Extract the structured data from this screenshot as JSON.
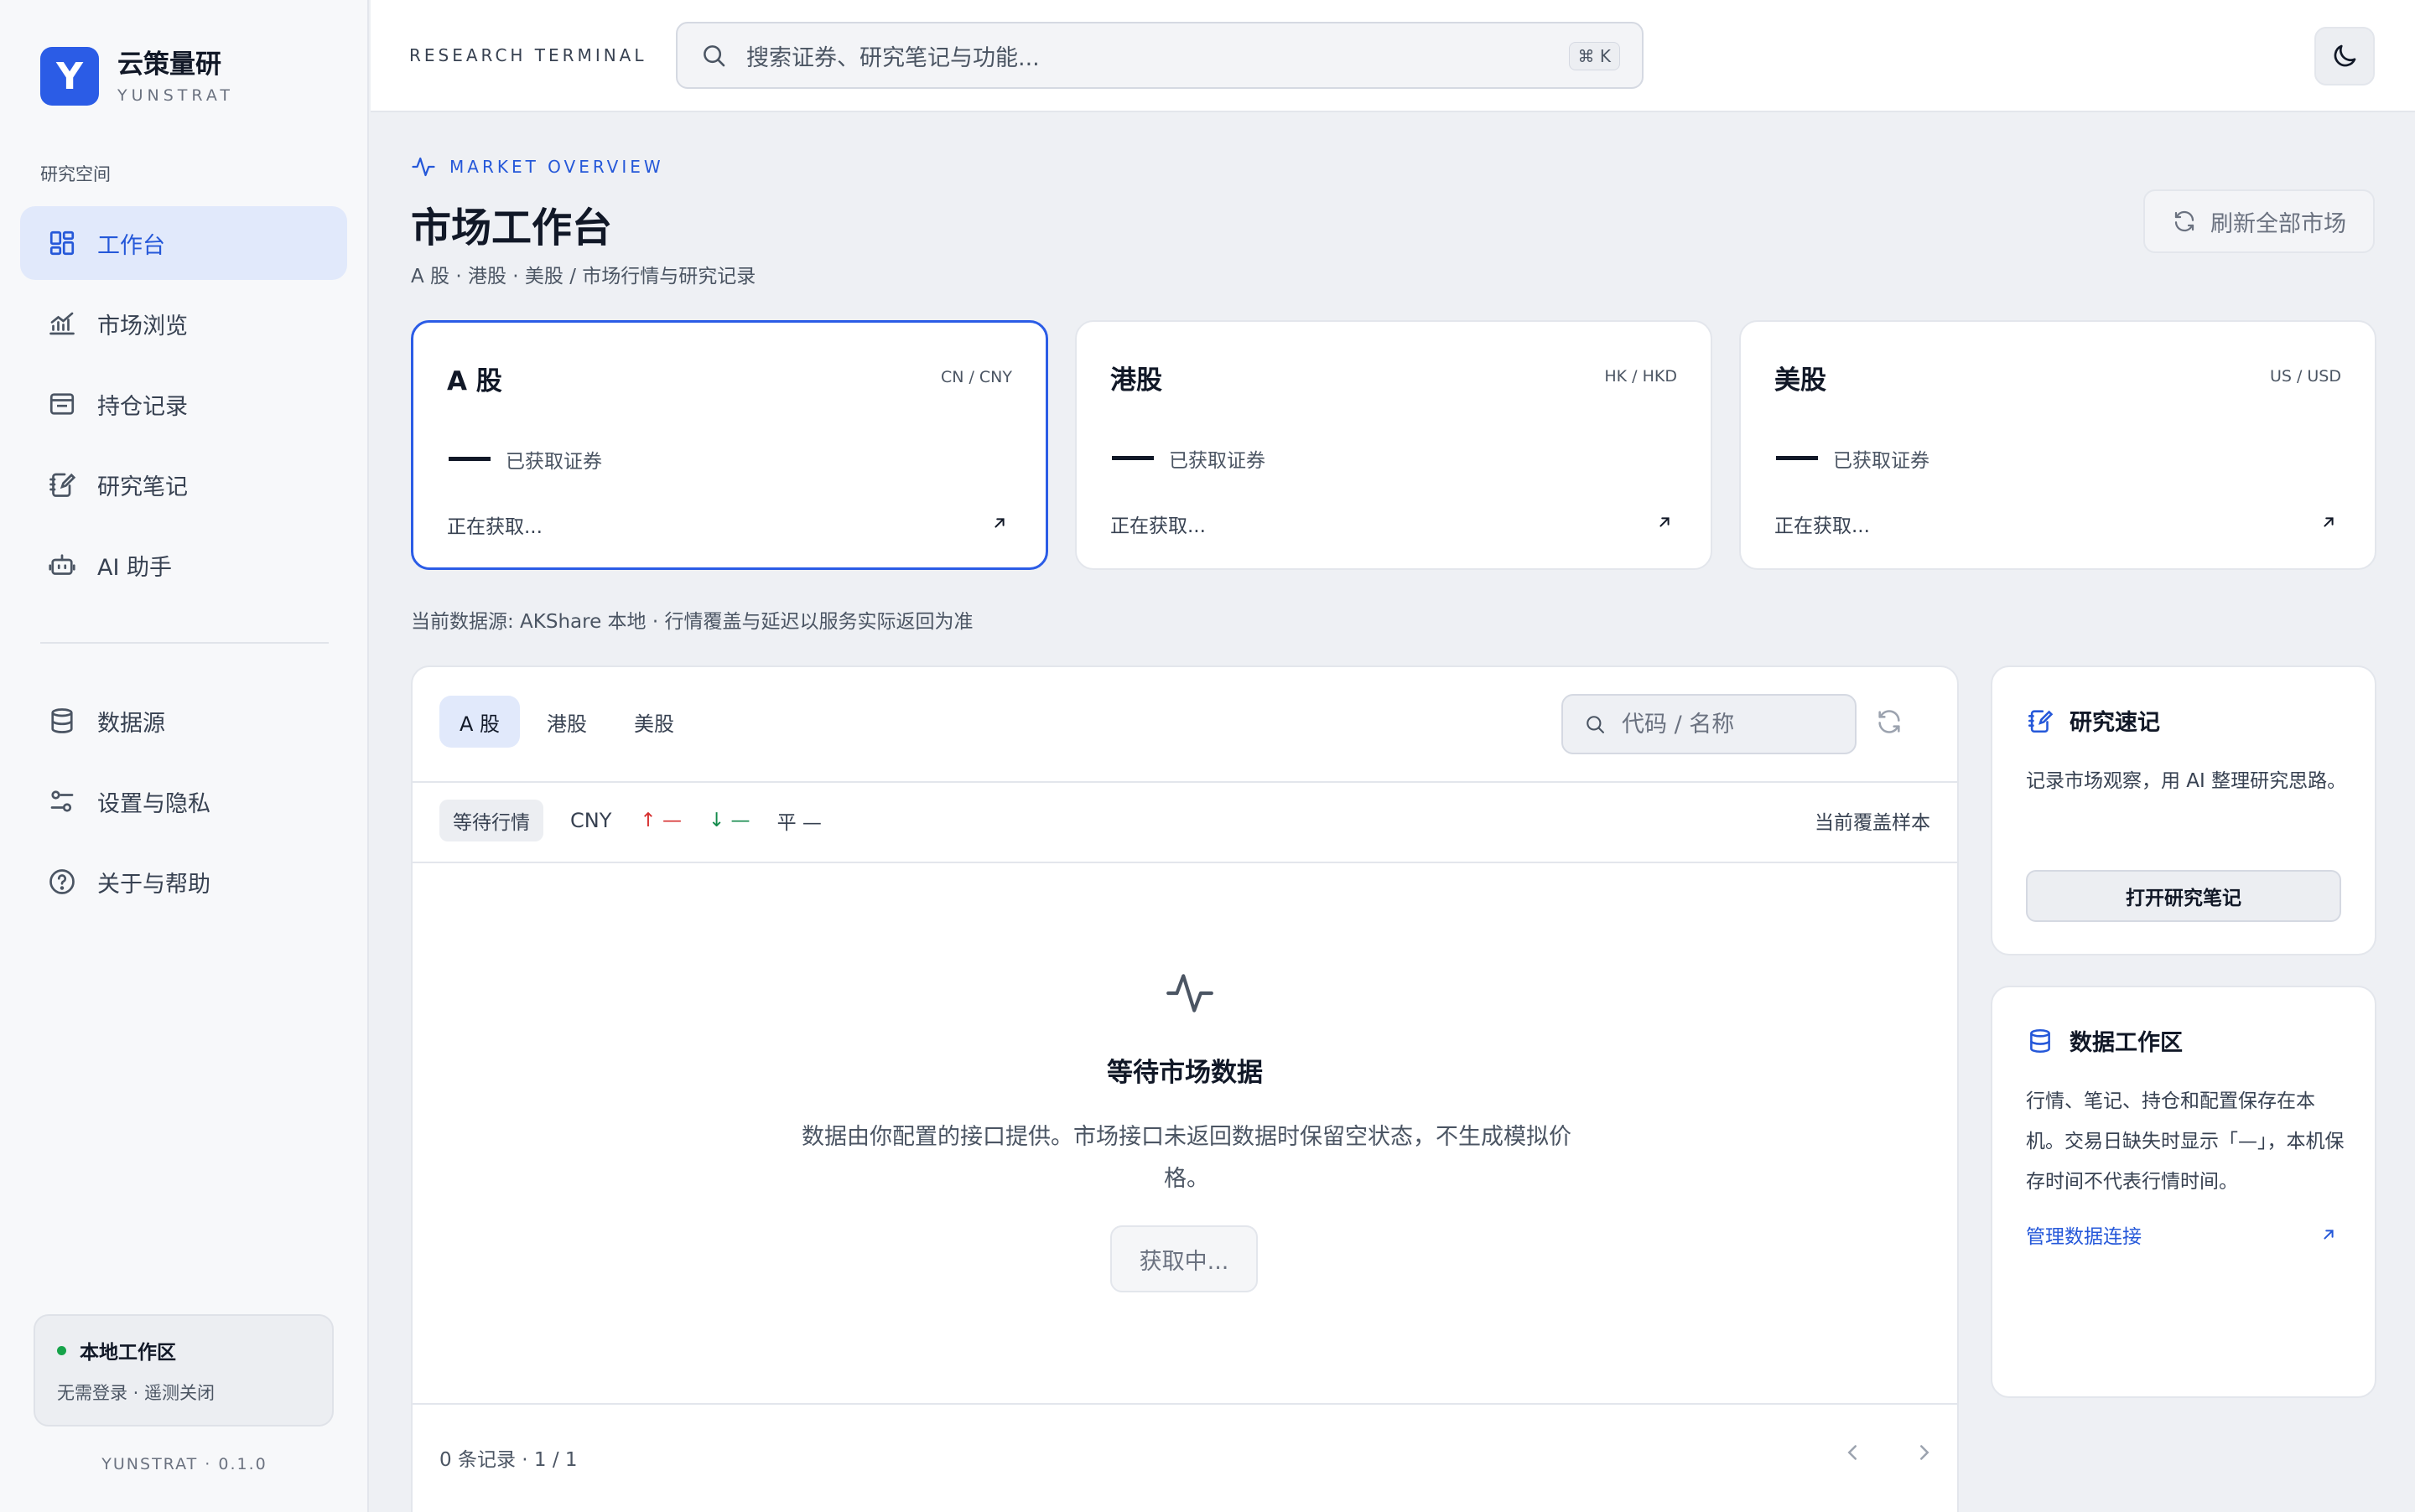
{
  "brand": {
    "logo_letter": "Y",
    "name": "云策量研",
    "sub": "YUNSTRAT"
  },
  "sidebar": {
    "section_label": "研究空间",
    "items": [
      {
        "label": "工作台",
        "icon": "dashboard-icon",
        "active": true
      },
      {
        "label": "市场浏览",
        "icon": "chart-icon"
      },
      {
        "label": "持仓记录",
        "icon": "wallet-icon"
      },
      {
        "label": "研究笔记",
        "icon": "notebook-icon"
      },
      {
        "label": "AI 助手",
        "icon": "robot-icon"
      }
    ],
    "secondary_items": [
      {
        "label": "数据源",
        "icon": "database-icon"
      },
      {
        "label": "设置与隐私",
        "icon": "sliders-icon"
      },
      {
        "label": "关于与帮助",
        "icon": "help-icon"
      }
    ],
    "workspace": {
      "title": "本地工作区",
      "sub": "无需登录 · 遥测关闭",
      "status_color": "#16a34a"
    },
    "version": "YUNSTRAT · 0.1.0"
  },
  "topbar": {
    "label": "RESEARCH TERMINAL",
    "search_placeholder": "搜索证券、研究笔记与功能...",
    "shortcut": "⌘ K",
    "theme_icon": "moon-icon"
  },
  "main": {
    "overline": "MARKET OVERVIEW",
    "title": "市场工作台",
    "subtitle": "A 股 · 港股 · 美股 / 市场行情与研究记录",
    "refresh_all_label": "刷新全部市场",
    "markets": [
      {
        "name": "A 股",
        "code": "CN / CNY",
        "count_label": "已获取证券",
        "status": "正在获取...",
        "active": true
      },
      {
        "name": "港股",
        "code": "HK / HKD",
        "count_label": "已获取证券",
        "status": "正在获取..."
      },
      {
        "name": "美股",
        "code": "US / USD",
        "count_label": "已获取证券",
        "status": "正在获取..."
      }
    ],
    "source_note": "当前数据源: AKShare 本地 · 行情覆盖与延迟以服务实际返回为准",
    "panel": {
      "tabs": [
        {
          "label": "A 股",
          "active": true
        },
        {
          "label": "港股"
        },
        {
          "label": "美股"
        }
      ],
      "search_placeholder": "代码 / 名称",
      "status_badge": "等待行情",
      "currency": "CNY",
      "up": "↑ —",
      "down": "↓ —",
      "flat": "平 —",
      "coverage": "当前覆盖样本",
      "empty_title": "等待市场数据",
      "empty_desc": "数据由你配置的接口提供。市场接口未返回数据时保留空状态，不生成模拟价格。",
      "fetch_label": "获取中...",
      "footer": "0 条记录 · 1 / 1"
    }
  },
  "right": {
    "notes": {
      "title": "研究速记",
      "text": "记录市场观察，用 AI 整理研究思路。",
      "button": "打开研究笔记"
    },
    "data": {
      "title": "数据工作区",
      "text": "行情、笔记、持仓和配置保存在本机。交易日缺失时显示「—」，本机保存时间不代表行情时间。",
      "link": "管理数据连接"
    }
  },
  "colors": {
    "accent": "#2b5ce6",
    "up": "#d62f2f",
    "down": "#138a4b"
  }
}
